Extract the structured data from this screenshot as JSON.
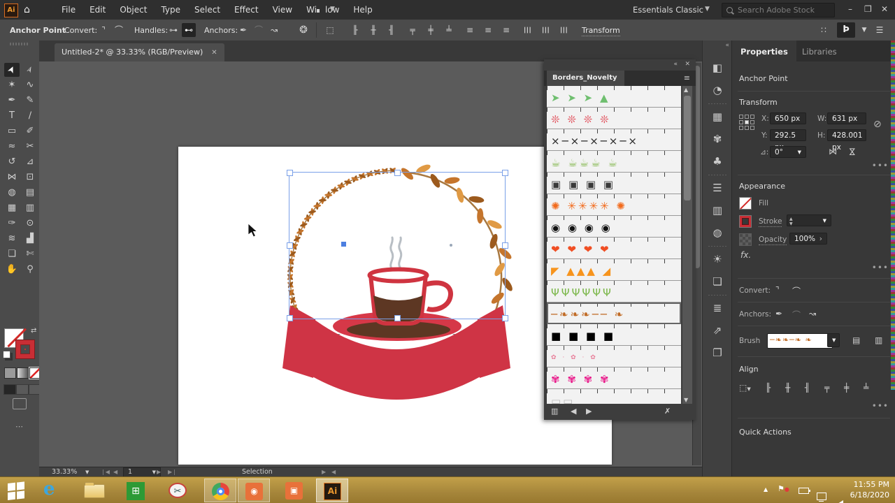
{
  "titlebar": {
    "app_badge": "Ai",
    "home_icon": "⌂",
    "menus": [
      "File",
      "Edit",
      "Object",
      "Type",
      "Select",
      "Effect",
      "View",
      "Window",
      "Help"
    ],
    "workspace": "Essentials Classic",
    "search_placeholder": "Search Adobe Stock",
    "minimize": "–",
    "restore": "❐",
    "close": "✕"
  },
  "control_bar": {
    "tool_label": "Anchor Point",
    "convert_label": "Convert:",
    "handles_label": "Handles:",
    "anchors_label": "Anchors:",
    "transform_link": "Transform",
    "icons": {
      "convert_corner": "⌝",
      "convert_smooth": "⌒",
      "handles_hide": "⊶",
      "handles_show": "⊷",
      "anchor_add": "✒",
      "anchor_curve": "⌒",
      "anchor_reshape": "↝",
      "recolor": "❂",
      "align_to": "⬚",
      "align": [
        "╟",
        "╫",
        "╢",
        "╤",
        "╪",
        "╧",
        "≡",
        "≡",
        "≡",
        "☰",
        "☰",
        "☰"
      ],
      "grid": "∷",
      "panel_toggle": "Þ",
      "menu": "☰"
    }
  },
  "document_tab": {
    "title": "Untitled-2* @ 33.33% (RGB/Preview)",
    "close": "✕"
  },
  "toolbar": {
    "tools": [
      {
        "name": "selection",
        "glyph": "➤"
      },
      {
        "name": "direct-selection",
        "glyph": "➢"
      },
      {
        "name": "magic-wand",
        "glyph": "✶"
      },
      {
        "name": "lasso",
        "glyph": "∿"
      },
      {
        "name": "pen",
        "glyph": "✒"
      },
      {
        "name": "curvature",
        "glyph": "✎"
      },
      {
        "name": "type",
        "glyph": "T"
      },
      {
        "name": "line-segment",
        "glyph": "∕"
      },
      {
        "name": "rectangle",
        "glyph": "▭"
      },
      {
        "name": "paintbrush",
        "glyph": "✐"
      },
      {
        "name": "shaper",
        "glyph": "≈"
      },
      {
        "name": "scissors",
        "glyph": "✂"
      },
      {
        "name": "rotate",
        "glyph": "↺"
      },
      {
        "name": "scale",
        "glyph": "⊿"
      },
      {
        "name": "width",
        "glyph": "⋈"
      },
      {
        "name": "free-transform",
        "glyph": "⊡"
      },
      {
        "name": "shape-builder",
        "glyph": "◍"
      },
      {
        "name": "perspective-grid",
        "glyph": "▤"
      },
      {
        "name": "mesh",
        "glyph": "▦"
      },
      {
        "name": "gradient",
        "glyph": "▥"
      },
      {
        "name": "eyedropper",
        "glyph": "✑"
      },
      {
        "name": "blend",
        "glyph": "⊙"
      },
      {
        "name": "symbol-sprayer",
        "glyph": "≋"
      },
      {
        "name": "column-graph",
        "glyph": "▟"
      },
      {
        "name": "artboard",
        "glyph": "❏"
      },
      {
        "name": "slice",
        "glyph": "✄"
      },
      {
        "name": "hand",
        "glyph": "✋"
      },
      {
        "name": "zoom",
        "glyph": "⚲"
      }
    ],
    "more": "⋯"
  },
  "brushes_panel": {
    "title": "Borders_Novelty",
    "selected_row": "autumn-leaves",
    "rows": [
      {
        "name": "green-arrows",
        "glyph": "➤ ➤ ➤ ▲",
        "color": "#6fbf6f"
      },
      {
        "name": "red-atoms",
        "glyph": "❊ ❊ ❊ ❊",
        "color": "#e25560"
      },
      {
        "name": "barbed-wire",
        "glyph": "⨯─⨯─⨯─⨯─⨯",
        "color": "#2a2a2a"
      },
      {
        "name": "teacups",
        "glyph": "☕ ☕☕☕ ☕",
        "color": "#7cb342"
      },
      {
        "name": "railroad",
        "glyph": "▣ ▣ ▣ ▣",
        "color": "#3a3a3a"
      },
      {
        "name": "orange-asterisks",
        "glyph": "✺ ✳✳✳✳ ✺",
        "color": "#f26a1b"
      },
      {
        "name": "hands",
        "glyph": "◉ ◉ ◉ ◉",
        "color": "#111111"
      },
      {
        "name": "hearts",
        "glyph": "❤ ❤ ❤ ❤",
        "color": "#f04e23"
      },
      {
        "name": "party-garland",
        "glyph": "◤ ▲▲▲ ◢",
        "color": "#f7941d"
      },
      {
        "name": "grass",
        "glyph": "ΨΨΨΨΨΨ",
        "color": "#7ab648"
      },
      {
        "name": "autumn-leaves",
        "glyph": "─❧❧❧── ❧",
        "color": "#c06a24"
      },
      {
        "name": "film-strip",
        "glyph": "■ ■ ■ ■",
        "color": "#000000"
      },
      {
        "name": "flower-dots",
        "glyph": "✿ · ✿ · ✿",
        "color": "#e87f9a"
      },
      {
        "name": "pink-flowers",
        "glyph": "✾ ✾ ✾ ✾",
        "color": "#e91e8c"
      },
      {
        "name": "partial-row",
        "glyph": "▭▭",
        "color": "#bbbbbb"
      }
    ],
    "footer": {
      "library": "▥",
      "prev": "◀",
      "next": "▶",
      "delete": "✗"
    },
    "header": {
      "collapse": "«",
      "close": "✕",
      "menu": "≡"
    }
  },
  "dock_icons": [
    {
      "name": "color",
      "glyph": "◧"
    },
    {
      "name": "color-guide",
      "glyph": "◔"
    },
    {
      "name": "swatches",
      "glyph": "▦"
    },
    {
      "name": "brushes",
      "glyph": "✾"
    },
    {
      "name": "symbols",
      "glyph": "♣"
    },
    {
      "name": "stroke",
      "glyph": "☰"
    },
    {
      "name": "gradient",
      "glyph": "▥"
    },
    {
      "name": "transparency",
      "glyph": "◍"
    },
    {
      "name": "appearance",
      "glyph": "☀"
    },
    {
      "name": "graphic-styles",
      "glyph": "❏"
    },
    {
      "name": "layers",
      "glyph": "≣"
    },
    {
      "name": "export",
      "glyph": "⇗"
    },
    {
      "name": "artboards",
      "glyph": "❐"
    }
  ],
  "properties": {
    "tabs": [
      "Properties",
      "Libraries"
    ],
    "selected_object": "Anchor Point",
    "transform": {
      "label": "Transform",
      "x_label": "X:",
      "x": "650 px",
      "y_label": "Y:",
      "y": "292.5 px",
      "w_label": "W:",
      "w": "631 px",
      "h_label": "H:",
      "h": "428.001 px",
      "angle_label": "⊿:",
      "angle": "0°",
      "flip_h": "⋈",
      "flip_v": "⋈",
      "link": "⊘"
    },
    "appearance": {
      "label": "Appearance",
      "fill_label": "Fill",
      "stroke_label": "Stroke",
      "stroke_value": "",
      "opacity_label": "Opacity",
      "opacity": "100%",
      "fx": "fx."
    },
    "convert_label": "Convert:",
    "anchors_label": "Anchors:",
    "brush_label": "Brush",
    "brush_preview": "─❧❧─❧  ❧",
    "align_label": "Align",
    "quick_actions_label": "Quick Actions",
    "more": "•••"
  },
  "status_bar": {
    "zoom": "33.33%",
    "artboard_num": "1",
    "status": "Selection",
    "nav": {
      "first": "❘◀",
      "prev": "◀",
      "next": "▶",
      "last": "▶❘"
    }
  },
  "taskbar": {
    "items": [
      "start",
      "internet-explorer",
      "file-explorer",
      "windows-store",
      "snipping-tool",
      "chrome",
      "screen-recorder",
      "screen-capture",
      "illustrator"
    ],
    "time": "11:55 PM",
    "date": "6/18/2020"
  },
  "artwork": {
    "description": "coffee cup logo with autumn leaf wreath and red ribbon banner",
    "colors": {
      "ribbon_red": "#cf3445",
      "ribbon_fold": "#7e8285",
      "cup_red": "#cf3440",
      "coffee_brown": "#5d3723",
      "saucer_red": "#d63848",
      "saucer_brown": "#5d3723",
      "leaf_dark": "#9c5a1d",
      "leaf_mid": "#c5752c",
      "leaf_light": "#e09a44",
      "stem": "#a87840",
      "steam_gray": "#b8bec4",
      "selection_blue": "#7aa0e8"
    }
  }
}
